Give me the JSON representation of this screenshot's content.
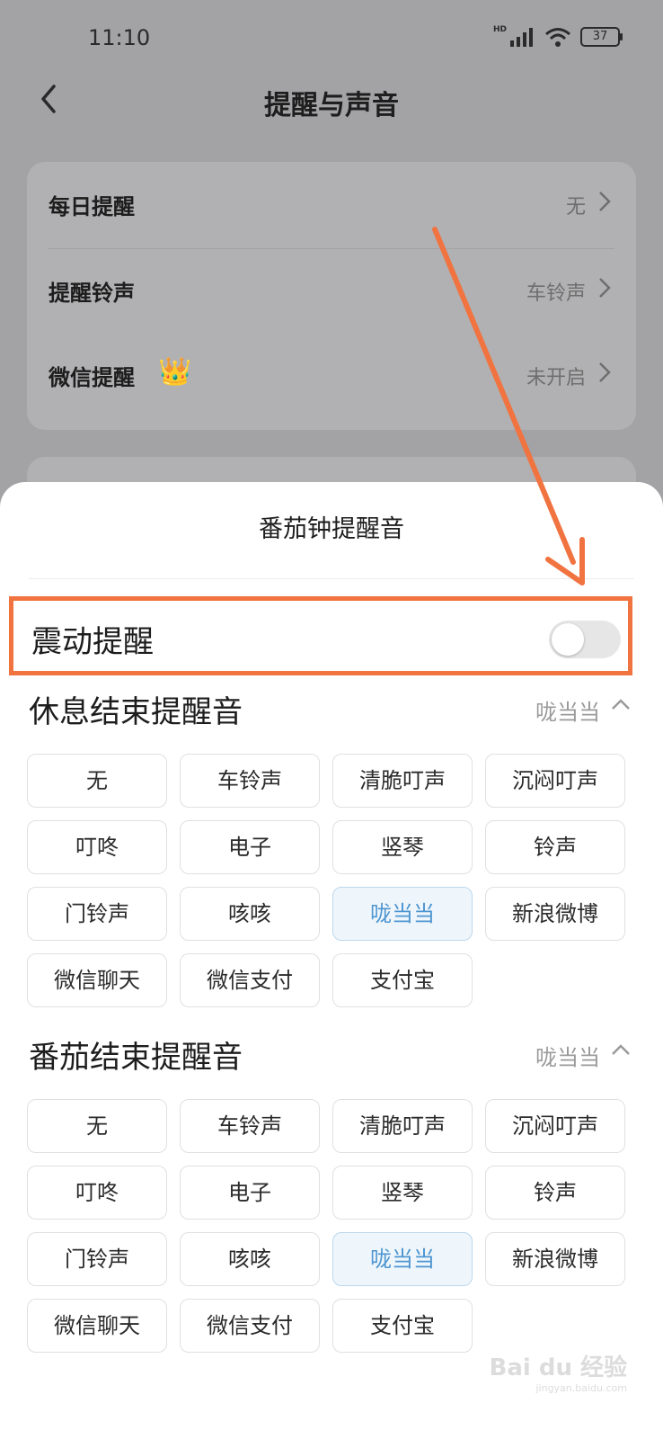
{
  "status_bar": {
    "time": "11:10",
    "network": "HD",
    "battery": "37"
  },
  "nav": {
    "title": "提醒与声音"
  },
  "settings": [
    {
      "label": "每日提醒",
      "value": "无"
    },
    {
      "label": "提醒铃声",
      "value": "车铃声"
    },
    {
      "label": "微信提醒",
      "value": "未开启",
      "badge": "crown"
    }
  ],
  "sheet": {
    "title": "番茄钟提醒音",
    "vibration": {
      "label": "震动提醒",
      "enabled": false
    },
    "rest_section": {
      "title": "休息结束提醒音",
      "value": "咙当当",
      "options": [
        "无",
        "车铃声",
        "清脆叮声",
        "沉闷叮声",
        "叮咚",
        "电子",
        "竖琴",
        "铃声",
        "门铃声",
        "咳咳",
        "咙当当",
        "新浪微博",
        "微信聊天",
        "微信支付",
        "支付宝"
      ],
      "selected": "咙当当"
    },
    "tomato_section": {
      "title": "番茄结束提醒音",
      "value": "咙当当",
      "options": [
        "无",
        "车铃声",
        "清脆叮声",
        "沉闷叮声",
        "叮咚",
        "电子",
        "竖琴",
        "铃声",
        "门铃声",
        "咳咳",
        "咙当当",
        "新浪微博",
        "微信聊天",
        "微信支付",
        "支付宝"
      ],
      "selected": "咙当当"
    }
  },
  "watermark": {
    "brand": "Bai du 经验",
    "url": "jingyan.baidu.com"
  },
  "colors": {
    "highlight": "#f07340",
    "selected_text": "#4e95d0",
    "selected_bg": "#eef6fc"
  }
}
